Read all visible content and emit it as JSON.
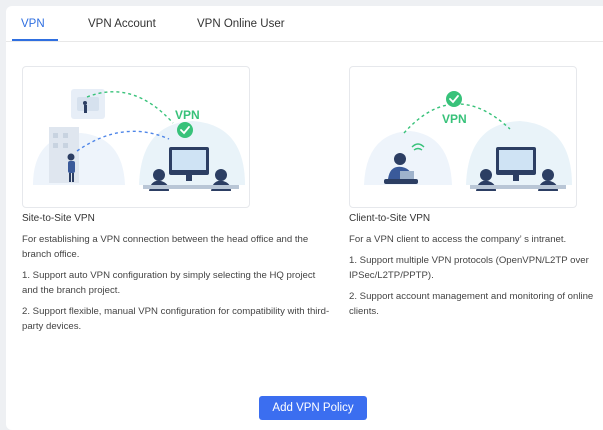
{
  "tabs": [
    {
      "label": "VPN",
      "active": true
    },
    {
      "label": "VPN Account",
      "active": false
    },
    {
      "label": "VPN Online User",
      "active": false
    }
  ],
  "cards": {
    "site_to_site": {
      "illustration_label": "VPN",
      "title": "Site-to-Site VPN",
      "description": "For establishing a VPN connection between the head office and the branch office.",
      "features": [
        "1. Support auto VPN configuration by simply selecting the HQ project and the branch project.",
        "2. Support flexible, manual VPN configuration for compatibility with third-party devices."
      ]
    },
    "client_to_site": {
      "illustration_label": "VPN",
      "title": "Client-to-Site VPN",
      "description": "For a VPN client to access the company’ s intranet.",
      "features": [
        "1. Support multiple VPN protocols (OpenVPN/L2TP over IPSec/L2TP/PPTP).",
        "2. Support account management and monitoring of online clients."
      ]
    }
  },
  "actions": {
    "add_policy_label": "Add VPN Policy"
  },
  "colors": {
    "accent": "#2f6fe0",
    "button": "#3b6ef0",
    "check_green": "#38c27a",
    "illustration_navy": "#2c3e63"
  }
}
